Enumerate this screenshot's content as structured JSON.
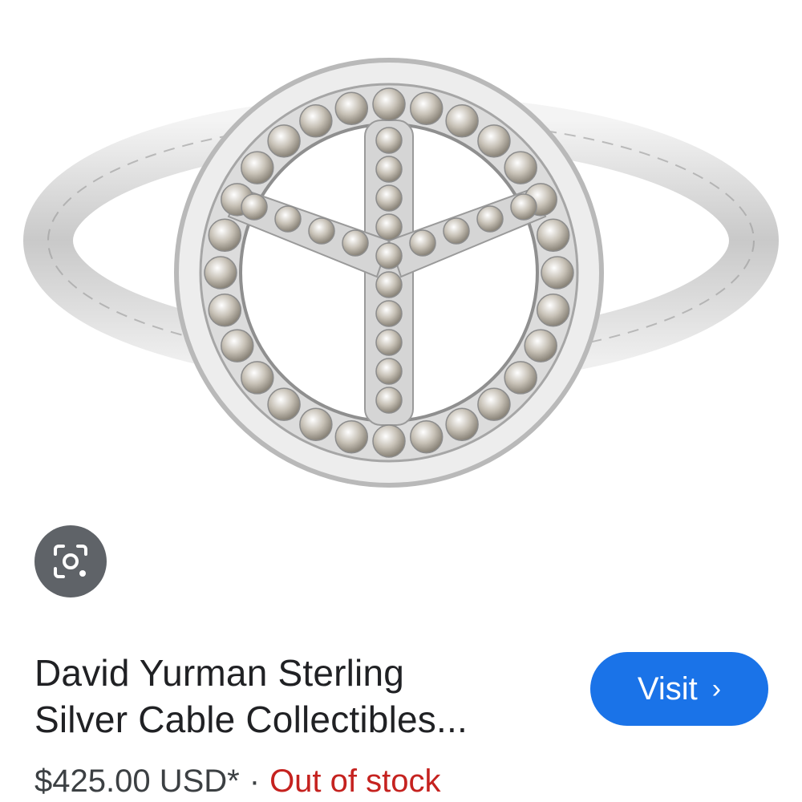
{
  "product": {
    "image_alt": "Peace sign diamond ring",
    "title_line1": "David Yurman Sterling",
    "title_line2": "Silver Cable Collectibles...",
    "price": "$425.00 USD*",
    "separator": "·",
    "availability": "Out of stock"
  },
  "actions": {
    "visit_label": "Visit",
    "visit_chevron": "›",
    "lens_icon": "lens-camera-icon"
  },
  "colors": {
    "visit_button": "#1a73e8",
    "out_of_stock": "#c5221f",
    "lens_button": "#5f6368",
    "title_text": "#202124"
  }
}
